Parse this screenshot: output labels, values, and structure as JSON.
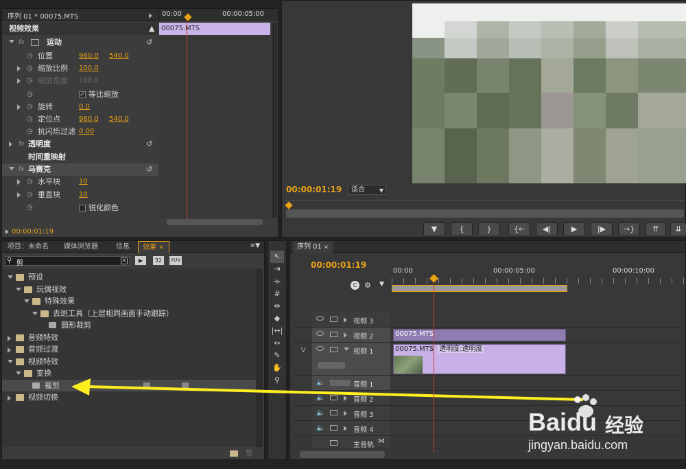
{
  "effect_controls": {
    "seq_title": "序列 01 * 00075.MTS",
    "tc_start": "00:00",
    "tc_end": "00:00:05:00",
    "section": "视频效果",
    "clip_name": "00075.MTS",
    "footer_time": "00:00:01:19",
    "rows": [
      {
        "label": "运动",
        "bold": true
      },
      {
        "label": "位置",
        "v1": "960.0",
        "v2": "540.0"
      },
      {
        "label": "缩放比例",
        "v1": "100.0"
      },
      {
        "label": "缩放宽度",
        "v1": "100.0",
        "disabled": true
      },
      {
        "label": "等比缩放",
        "checkbox": true
      },
      {
        "label": "旋转",
        "v1": "0.0"
      },
      {
        "label": "定位点",
        "v1": "960.0",
        "v2": "540.0"
      },
      {
        "label": "抗闪烁过滤",
        "v1": "0.00"
      },
      {
        "label": "透明度",
        "bold": true
      },
      {
        "label": "时间重映射",
        "bold": true
      },
      {
        "label": "马赛克",
        "bold": true
      },
      {
        "label": "水平块",
        "v1": "10"
      },
      {
        "label": "垂直块",
        "v1": "10"
      },
      {
        "label": "锐化颜色",
        "checkbox": true
      }
    ]
  },
  "program_monitor": {
    "timecode": "00:00:01:19",
    "fit_label": "适合",
    "transport": [
      "▼",
      "{",
      "}",
      "{←",
      "◀|",
      "▶",
      "|▶",
      "→}"
    ]
  },
  "project_panel": {
    "tabs": [
      "项目：未命名",
      "媒体浏览器",
      "信息",
      "效果"
    ],
    "search_value": "剪",
    "badges": [
      "32",
      "YUV"
    ],
    "tree": [
      {
        "label": "预设",
        "level": 0,
        "open": true
      },
      {
        "label": "玩偶视效",
        "level": 1,
        "open": true
      },
      {
        "label": "特殊效果",
        "level": 2,
        "open": true
      },
      {
        "label": "去斑工具（上层相同画面手动跟踪）",
        "level": 3,
        "open": true
      },
      {
        "label": "圆形裁剪",
        "level": 4,
        "item": true
      },
      {
        "label": "音频特效",
        "level": 0
      },
      {
        "label": "音频过渡",
        "level": 0
      },
      {
        "label": "视频特效",
        "level": 0,
        "open": true
      },
      {
        "label": "变换",
        "level": 1,
        "open": true
      },
      {
        "label": "裁剪",
        "level": 2,
        "item": true,
        "selected": true
      },
      {
        "label": "视频切换",
        "level": 0
      }
    ]
  },
  "timeline": {
    "tab": "序列 01",
    "timecode": "00:00:01:19",
    "ruler": [
      "00:00",
      "00:00:05:00",
      "00:00:10:00"
    ],
    "tracks": [
      {
        "name": "视频 3",
        "type": "video"
      },
      {
        "name": "视频 2",
        "type": "video",
        "clip": "00075.MTS"
      },
      {
        "name": "视频 1",
        "type": "video",
        "clip": "00075.MTS",
        "clip_extra": "透明度:透明度",
        "side": "V"
      },
      {
        "name": "音频 1",
        "type": "audio"
      },
      {
        "name": "音频 2",
        "type": "audio"
      },
      {
        "name": "音频 3",
        "type": "audio"
      },
      {
        "name": "音频 4",
        "type": "audio"
      },
      {
        "name": "主音轨",
        "type": "master"
      }
    ]
  },
  "watermark": {
    "brand": "Bai",
    "brand2": "du",
    "cn": "经验",
    "url": "jingyan.baidu.com"
  }
}
